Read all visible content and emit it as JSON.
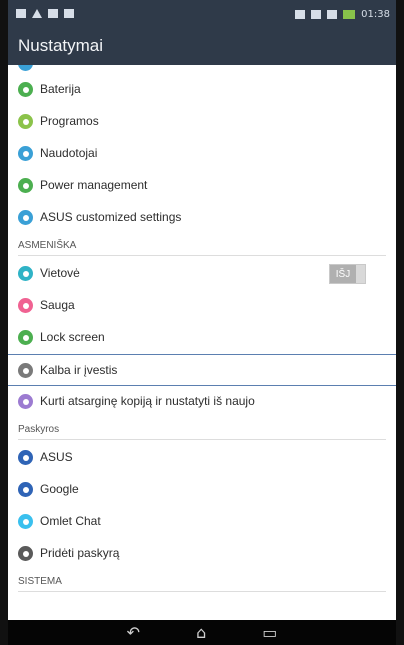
{
  "status": {
    "time": "01:38"
  },
  "header": {
    "title": "Nustatymai"
  },
  "items": [
    {
      "label": "Baterija",
      "color": "#4caf50",
      "icon": "battery-icon"
    },
    {
      "label": "Programos",
      "color": "#8bc34a",
      "icon": "apps-icon"
    },
    {
      "label": "Naudotojai",
      "color": "#3aa0d6",
      "icon": "users-icon"
    },
    {
      "label": "Power management",
      "color": "#4caf50",
      "icon": "power-icon"
    },
    {
      "label": "ASUS customized settings",
      "color": "#3aa0d6",
      "icon": "asus-settings-icon"
    }
  ],
  "section_personal": "ASMENIŠKA",
  "personal": [
    {
      "label": "Vietovė",
      "color": "#2fb3c6",
      "icon": "location-icon",
      "toggle": "IŠJ"
    },
    {
      "label": "Sauga",
      "color": "#f06292",
      "icon": "security-icon"
    },
    {
      "label": "Lock screen",
      "color": "#4caf50",
      "icon": "lock-icon"
    },
    {
      "label": "Kalba ir įvestis",
      "color": "#7a7a7a",
      "icon": "language-icon"
    },
    {
      "label": "Kurti atsarginę kopiją ir nustatyti iš naujo",
      "color": "#9c7bd1",
      "icon": "backup-icon"
    }
  ],
  "section_accounts": "Paskyros",
  "accounts": [
    {
      "label": "ASUS",
      "color": "#2f64b6",
      "icon": "asus-icon"
    },
    {
      "label": "Google",
      "color": "#2f64b6",
      "icon": "google-icon"
    },
    {
      "label": "Omlet Chat",
      "color": "#3ac0ee",
      "icon": "omlet-icon"
    },
    {
      "label": "Pridėti paskyrą",
      "color": "#5a5a5a",
      "icon": "add-account-icon"
    }
  ],
  "section_system": "SISTEMA",
  "nav": {
    "back": "↶",
    "home": "⌂",
    "recent": "▭"
  }
}
